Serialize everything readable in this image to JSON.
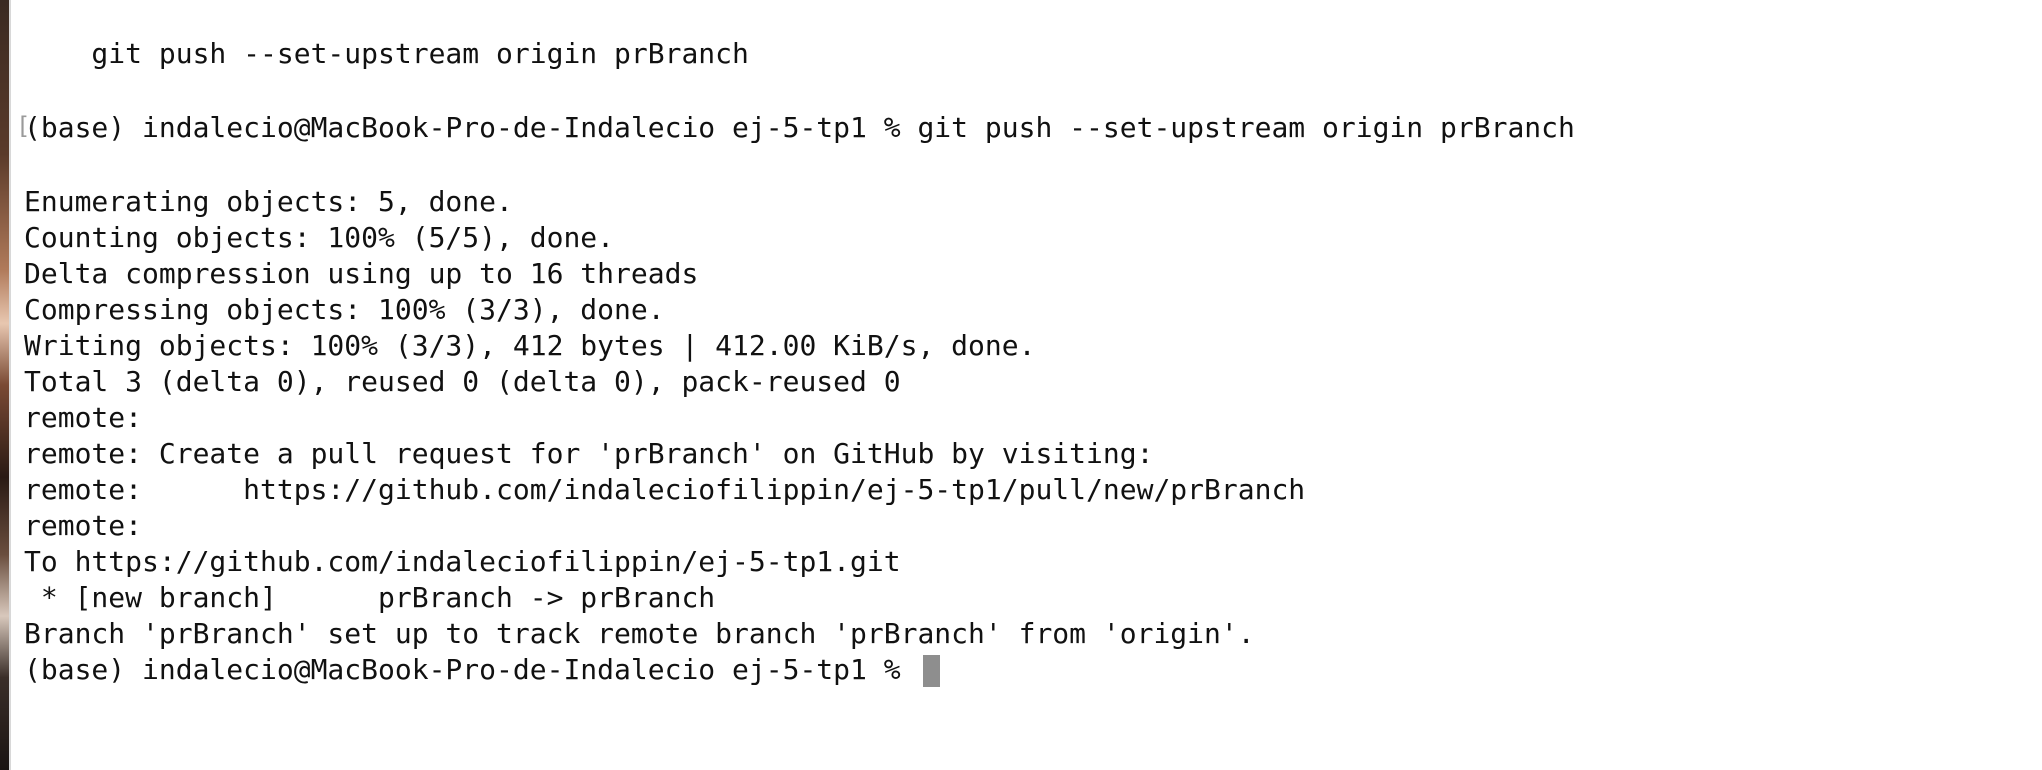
{
  "terminal": {
    "lines": [
      "    git push --set-upstream origin prBranch",
      "",
      "(base) indalecio@MacBook-Pro-de-Indalecio ej-5-tp1 % git push --set-upstream origin prBranch",
      "",
      "Enumerating objects: 5, done.",
      "Counting objects: 100% (5/5), done.",
      "Delta compression using up to 16 threads",
      "Compressing objects: 100% (3/3), done.",
      "Writing objects: 100% (3/3), 412 bytes | 412.00 KiB/s, done.",
      "Total 3 (delta 0), reused 0 (delta 0), pack-reused 0",
      "remote:",
      "remote: Create a pull request for 'prBranch' on GitHub by visiting:",
      "remote:      https://github.com/indaleciofilippin/ej-5-tp1/pull/new/prBranch",
      "remote:",
      "To https://github.com/indaleciofilippin/ej-5-tp1.git",
      " * [new branch]      prBranch -> prBranch",
      "Branch 'prBranch' set up to track remote branch 'prBranch' from 'origin'.",
      "(base) indalecio@MacBook-Pro-de-Indalecio ej-5-tp1 % "
    ],
    "command_marker": "["
  }
}
